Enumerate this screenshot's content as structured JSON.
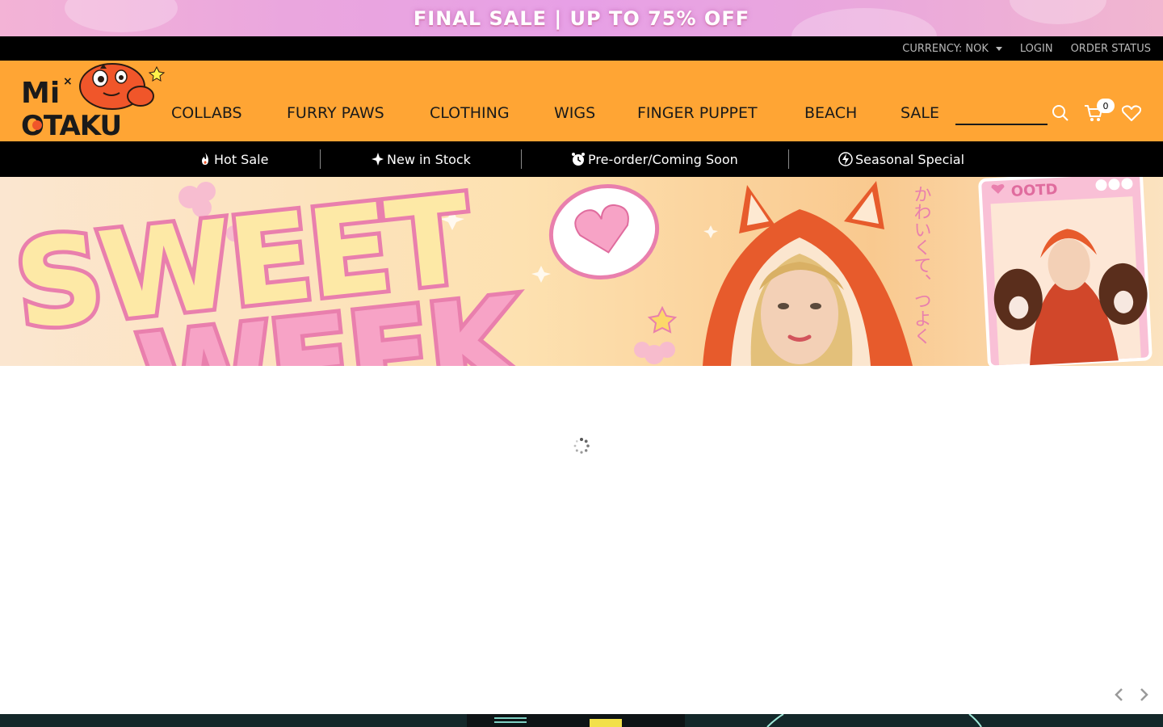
{
  "promo": {
    "text": "FINAL SALE  | UP TO 75% OFF"
  },
  "utility": {
    "currency": "CURRENCY: NOK",
    "login": "LOGIN",
    "order_status": "ORDER STATUS"
  },
  "brand": {
    "name": "MioOtaku"
  },
  "nav": {
    "items": [
      "COLLABS",
      "FURRY PAWS",
      "CLOTHING",
      "WIGS",
      "FINGER PUPPET",
      "BEACH",
      "SALE"
    ],
    "cart_count": "0"
  },
  "subnav": {
    "items": [
      "Hot Sale",
      "New in Stock",
      "Pre-order/Coming Soon",
      "Seasonal Special"
    ]
  },
  "hero": {
    "headline": "SWEET WEEK",
    "tag": "OOTD",
    "japanese": "かわいくて、つよく"
  },
  "colors": {
    "nav_orange": "#ffa534",
    "promo_pink": "#e7a0e6",
    "black": "#000000"
  }
}
